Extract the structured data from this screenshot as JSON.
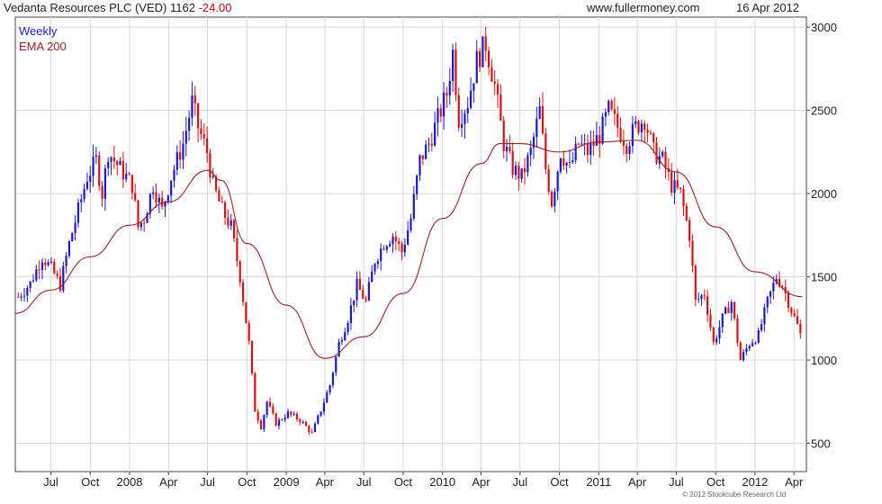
{
  "header": {
    "title": "Vedanta Resources PLC (VED) 1162",
    "change": "-24.00",
    "site": "www.fullermoney.com",
    "date": "16 Apr 2012"
  },
  "copyright": "© 2012 Stockcube Research Ltd",
  "colors": {
    "up_candle": "#1a1acc",
    "down_candle": "#dd1111",
    "ema": "#a02020",
    "grid": "#d8d8d8",
    "axis": "#444444"
  },
  "chart_data": {
    "type": "candlestick",
    "title": "Vedanta Resources PLC (VED) 1162",
    "timeframe": "Weekly",
    "legend": [
      {
        "name": "Weekly",
        "color": "#1a1acc"
      },
      {
        "name": "EMA 200",
        "color": "#a02020"
      }
    ],
    "legend_position": "top-left",
    "y_axis_position": "right",
    "grid": true,
    "ylim": [
      330,
      3060
    ],
    "y_ticks": [
      500,
      1000,
      1500,
      2000,
      2500,
      3000
    ],
    "y_tick_labels": [
      "500",
      "1000",
      "1500",
      "2000",
      "2500",
      "3000"
    ],
    "x_range": [
      "2007-04-09",
      "2012-04-30"
    ],
    "x_ticks": [
      {
        "date": "2007-07-01",
        "label": "Jul"
      },
      {
        "date": "2007-10-01",
        "label": "Oct"
      },
      {
        "date": "2008-01-01",
        "label": "2008"
      },
      {
        "date": "2008-04-01",
        "label": "Apr"
      },
      {
        "date": "2008-07-01",
        "label": "Jul"
      },
      {
        "date": "2008-10-01",
        "label": "Oct"
      },
      {
        "date": "2009-01-01",
        "label": "2009"
      },
      {
        "date": "2009-04-01",
        "label": "Apr"
      },
      {
        "date": "2009-07-01",
        "label": "Jul"
      },
      {
        "date": "2009-10-01",
        "label": "Oct"
      },
      {
        "date": "2010-01-01",
        "label": "2010"
      },
      {
        "date": "2010-04-01",
        "label": "Apr"
      },
      {
        "date": "2010-07-01",
        "label": "Jul"
      },
      {
        "date": "2010-10-01",
        "label": "Oct"
      },
      {
        "date": "2011-01-01",
        "label": "2011"
      },
      {
        "date": "2011-04-01",
        "label": "Apr"
      },
      {
        "date": "2011-07-01",
        "label": "Jul"
      },
      {
        "date": "2011-10-01",
        "label": "Oct"
      },
      {
        "date": "2012-01-01",
        "label": "2012"
      },
      {
        "date": "2012-04-01",
        "label": "Apr"
      }
    ],
    "price_path": [
      [
        "2007-04-16",
        1380
      ],
      [
        "2007-05-14",
        1460
      ],
      [
        "2007-06-11",
        1620
      ],
      [
        "2007-07-02",
        1550
      ],
      [
        "2007-07-23",
        1450
      ],
      [
        "2007-08-13",
        1700
      ],
      [
        "2007-09-03",
        1900
      ],
      [
        "2007-09-24",
        2100
      ],
      [
        "2007-10-15",
        2200
      ],
      [
        "2007-10-29",
        2000
      ],
      [
        "2007-11-12",
        2250
      ],
      [
        "2007-12-10",
        2150
      ],
      [
        "2008-01-07",
        2050
      ],
      [
        "2008-01-21",
        1800
      ],
      [
        "2008-02-04",
        1850
      ],
      [
        "2008-02-25",
        2050
      ],
      [
        "2008-03-17",
        1900
      ],
      [
        "2008-04-07",
        2100
      ],
      [
        "2008-05-05",
        2300
      ],
      [
        "2008-05-26",
        2550
      ],
      [
        "2008-06-09",
        2400
      ],
      [
        "2008-06-30",
        2250
      ],
      [
        "2008-07-14",
        2050
      ],
      [
        "2008-08-04",
        1900
      ],
      [
        "2008-08-25",
        1800
      ],
      [
        "2008-09-15",
        1500
      ],
      [
        "2008-10-06",
        1100
      ],
      [
        "2008-10-20",
        700
      ],
      [
        "2008-11-03",
        600
      ],
      [
        "2008-11-17",
        750
      ],
      [
        "2008-12-08",
        620
      ],
      [
        "2009-01-05",
        680
      ],
      [
        "2009-02-02",
        640
      ],
      [
        "2009-03-02",
        560
      ],
      [
        "2009-03-23",
        700
      ],
      [
        "2009-04-13",
        850
      ],
      [
        "2009-05-04",
        1100
      ],
      [
        "2009-05-25",
        1250
      ],
      [
        "2009-06-15",
        1450
      ],
      [
        "2009-07-06",
        1350
      ],
      [
        "2009-07-27",
        1600
      ],
      [
        "2009-08-17",
        1700
      ],
      [
        "2009-09-07",
        1750
      ],
      [
        "2009-09-28",
        1650
      ],
      [
        "2009-10-19",
        1850
      ],
      [
        "2009-11-09",
        2200
      ],
      [
        "2009-11-30",
        2300
      ],
      [
        "2009-12-21",
        2450
      ],
      [
        "2010-01-11",
        2600
      ],
      [
        "2010-01-25",
        2850
      ],
      [
        "2010-02-08",
        2450
      ],
      [
        "2010-03-01",
        2550
      ],
      [
        "2010-03-22",
        2800
      ],
      [
        "2010-04-12",
        2900
      ],
      [
        "2010-05-03",
        2650
      ],
      [
        "2010-05-24",
        2300
      ],
      [
        "2010-06-14",
        2150
      ],
      [
        "2010-07-05",
        2100
      ],
      [
        "2010-07-26",
        2250
      ],
      [
        "2010-08-16",
        2500
      ],
      [
        "2010-08-30",
        2150
      ],
      [
        "2010-09-13",
        1950
      ],
      [
        "2010-10-04",
        2250
      ],
      [
        "2010-10-25",
        2150
      ],
      [
        "2010-11-15",
        2300
      ],
      [
        "2010-12-06",
        2250
      ],
      [
        "2011-01-03",
        2350
      ],
      [
        "2011-01-24",
        2500
      ],
      [
        "2011-02-14",
        2400
      ],
      [
        "2011-03-07",
        2300
      ],
      [
        "2011-03-28",
        2400
      ],
      [
        "2011-04-18",
        2450
      ],
      [
        "2011-05-09",
        2250
      ],
      [
        "2011-05-30",
        2200
      ],
      [
        "2011-06-20",
        2050
      ],
      [
        "2011-07-11",
        2000
      ],
      [
        "2011-08-01",
        1750
      ],
      [
        "2011-08-15",
        1350
      ],
      [
        "2011-09-05",
        1400
      ],
      [
        "2011-09-26",
        1100
      ],
      [
        "2011-10-17",
        1250
      ],
      [
        "2011-11-07",
        1350
      ],
      [
        "2011-11-28",
        1000
      ],
      [
        "2011-12-19",
        1100
      ],
      [
        "2012-01-09",
        1150
      ],
      [
        "2012-01-30",
        1350
      ],
      [
        "2012-02-20",
        1500
      ],
      [
        "2012-03-05",
        1450
      ],
      [
        "2012-03-26",
        1300
      ],
      [
        "2012-04-16",
        1162
      ]
    ],
    "ema_200": [
      [
        "2007-04-09",
        1280
      ],
      [
        "2007-07-01",
        1420
      ],
      [
        "2007-10-01",
        1620
      ],
      [
        "2008-01-01",
        1810
      ],
      [
        "2008-04-01",
        1950
      ],
      [
        "2008-07-01",
        2140
      ],
      [
        "2008-08-01",
        2080
      ],
      [
        "2008-10-01",
        1700
      ],
      [
        "2009-01-01",
        1330
      ],
      [
        "2009-04-01",
        1010
      ],
      [
        "2009-07-01",
        1140
      ],
      [
        "2009-10-01",
        1400
      ],
      [
        "2010-01-01",
        1850
      ],
      [
        "2010-04-01",
        2180
      ],
      [
        "2010-05-15",
        2300
      ],
      [
        "2010-07-01",
        2300
      ],
      [
        "2010-10-01",
        2250
      ],
      [
        "2011-01-01",
        2310
      ],
      [
        "2011-04-01",
        2320
      ],
      [
        "2011-07-01",
        2130
      ],
      [
        "2011-10-01",
        1800
      ],
      [
        "2012-01-01",
        1530
      ],
      [
        "2012-04-21",
        1380
      ]
    ]
  }
}
